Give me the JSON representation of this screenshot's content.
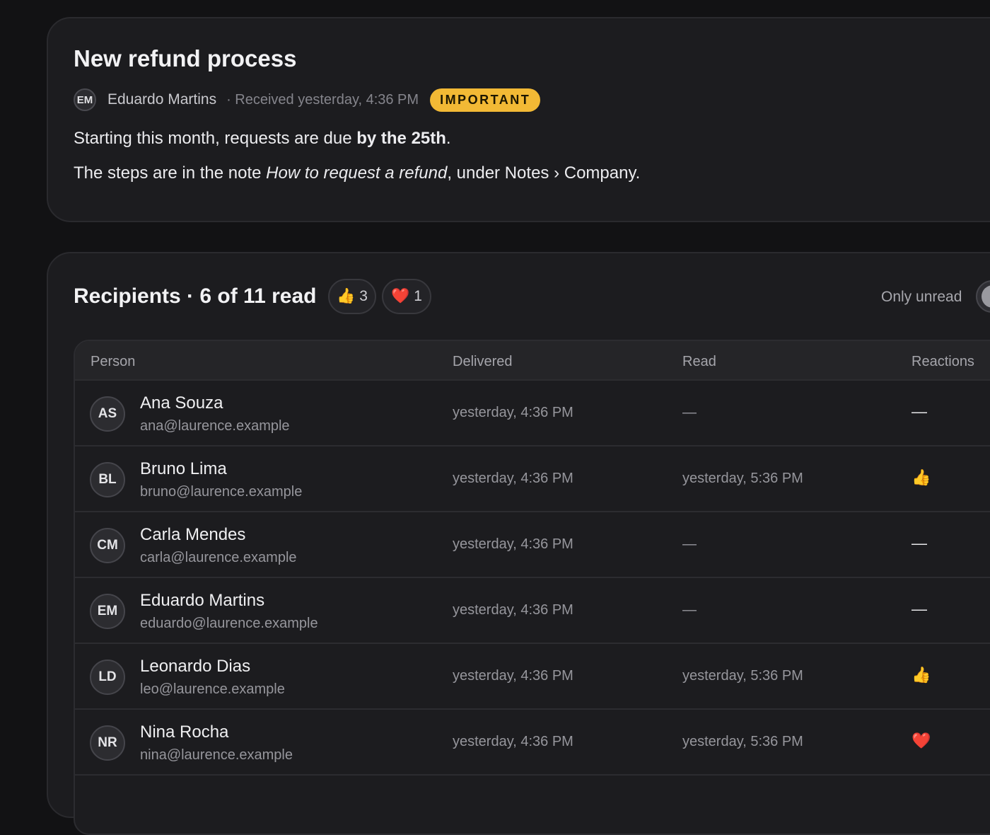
{
  "message": {
    "title": "New refund process",
    "sender_initials": "EM",
    "sender_name": "Eduardo Martins",
    "received": "· Received yesterday, 4:36 PM",
    "badge": "IMPORTANT",
    "line1_prefix": "Starting this month, requests are due ",
    "line1_bold": "by the 25th",
    "line1_suffix": ".",
    "line2_prefix": "The steps are in the note ",
    "line2_italic": "How to request a refund",
    "line2_suffix": ", under Notes › Company."
  },
  "recipients": {
    "title": "Recipients · 6 of 11 read",
    "reaction_chips": [
      {
        "emoji": "👍",
        "count": "3"
      },
      {
        "emoji": "❤️",
        "count": "1"
      }
    ],
    "only_unread_label": "Only unread",
    "only_unread_on": false,
    "columns": {
      "person": "Person",
      "delivered": "Delivered",
      "read": "Read",
      "reactions": "Reactions"
    },
    "rows": [
      {
        "initials": "AS",
        "name": "Ana Souza",
        "email": "ana@laurence.example",
        "delivered": "yesterday, 4:36 PM",
        "read": "—",
        "reaction": "—"
      },
      {
        "initials": "BL",
        "name": "Bruno Lima",
        "email": "bruno@laurence.example",
        "delivered": "yesterday, 4:36 PM",
        "read": "yesterday, 5:36 PM",
        "reaction": "👍"
      },
      {
        "initials": "CM",
        "name": "Carla Mendes",
        "email": "carla@laurence.example",
        "delivered": "yesterday, 4:36 PM",
        "read": "—",
        "reaction": "—"
      },
      {
        "initials": "EM",
        "name": "Eduardo Martins",
        "email": "eduardo@laurence.example",
        "delivered": "yesterday, 4:36 PM",
        "read": "—",
        "reaction": "—"
      },
      {
        "initials": "LD",
        "name": "Leonardo Dias",
        "email": "leo@laurence.example",
        "delivered": "yesterday, 4:36 PM",
        "read": "yesterday, 5:36 PM",
        "reaction": "👍"
      },
      {
        "initials": "NR",
        "name": "Nina Rocha",
        "email": "nina@laurence.example",
        "delivered": "yesterday, 4:36 PM",
        "read": "yesterday, 5:36 PM",
        "reaction": "❤️"
      }
    ]
  }
}
